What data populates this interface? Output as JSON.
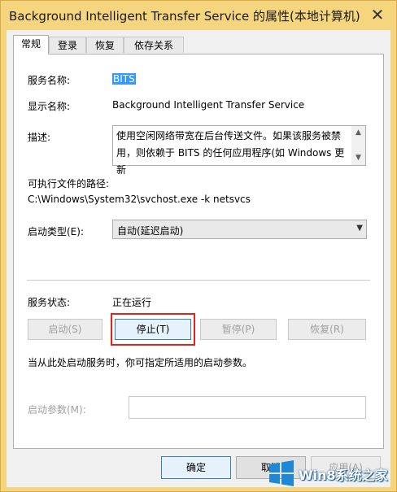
{
  "window": {
    "title": "Background Intelligent Transfer Service 的属性(本地计算机)",
    "close_glyph": "✕"
  },
  "tabs": [
    {
      "label": "常规",
      "active": true
    },
    {
      "label": "登录",
      "active": false
    },
    {
      "label": "恢复",
      "active": false
    },
    {
      "label": "依存关系",
      "active": false
    }
  ],
  "general": {
    "service_name_label": "服务名称:",
    "service_name_value": "BITS",
    "display_name_label": "显示名称:",
    "display_name_value": "Background Intelligent Transfer Service",
    "description_label": "描述:",
    "description_value": "使用空闲网络带宽在后台传送文件。如果该服务被禁用，则依赖于 BITS 的任何应用程序(如 Windows 更新",
    "exec_path_label": "可执行文件的路径:",
    "exec_path_value": "C:\\Windows\\System32\\svchost.exe -k netsvcs",
    "startup_type_label": "启动类型(E):",
    "startup_type_value": "自动(延迟启动)",
    "service_status_label": "服务状态:",
    "service_status_value": "正在运行",
    "start_button": "启动(S)",
    "stop_button": "停止(T)",
    "pause_button": "暂停(P)",
    "resume_button": "恢复(R)",
    "hint_text": "当从此处启动服务时，你可指定所适用的启动参数。",
    "start_params_label": "启动参数(M):",
    "start_params_value": ""
  },
  "footer": {
    "ok_button": "确定",
    "cancel_button": "取消",
    "apply_button": "应用(A)"
  },
  "watermark": {
    "text": "Win8系统之家"
  },
  "colors": {
    "highlight_box": "#e2231a",
    "selection": "#3399ff",
    "frame": "#f6d57f"
  }
}
